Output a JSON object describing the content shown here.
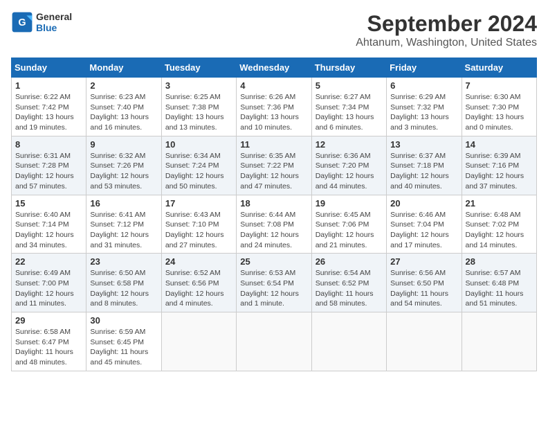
{
  "logo": {
    "line1": "General",
    "line2": "Blue"
  },
  "title": "September 2024",
  "subtitle": "Ahtanum, Washington, United States",
  "days_of_week": [
    "Sunday",
    "Monday",
    "Tuesday",
    "Wednesday",
    "Thursday",
    "Friday",
    "Saturday"
  ],
  "weeks": [
    [
      {
        "day": "1",
        "sunrise": "6:22 AM",
        "sunset": "7:42 PM",
        "daylight": "13 hours and 19 minutes."
      },
      {
        "day": "2",
        "sunrise": "6:23 AM",
        "sunset": "7:40 PM",
        "daylight": "13 hours and 16 minutes."
      },
      {
        "day": "3",
        "sunrise": "6:25 AM",
        "sunset": "7:38 PM",
        "daylight": "13 hours and 13 minutes."
      },
      {
        "day": "4",
        "sunrise": "6:26 AM",
        "sunset": "7:36 PM",
        "daylight": "13 hours and 10 minutes."
      },
      {
        "day": "5",
        "sunrise": "6:27 AM",
        "sunset": "7:34 PM",
        "daylight": "13 hours and 6 minutes."
      },
      {
        "day": "6",
        "sunrise": "6:29 AM",
        "sunset": "7:32 PM",
        "daylight": "13 hours and 3 minutes."
      },
      {
        "day": "7",
        "sunrise": "6:30 AM",
        "sunset": "7:30 PM",
        "daylight": "13 hours and 0 minutes."
      }
    ],
    [
      {
        "day": "8",
        "sunrise": "6:31 AM",
        "sunset": "7:28 PM",
        "daylight": "12 hours and 57 minutes."
      },
      {
        "day": "9",
        "sunrise": "6:32 AM",
        "sunset": "7:26 PM",
        "daylight": "12 hours and 53 minutes."
      },
      {
        "day": "10",
        "sunrise": "6:34 AM",
        "sunset": "7:24 PM",
        "daylight": "12 hours and 50 minutes."
      },
      {
        "day": "11",
        "sunrise": "6:35 AM",
        "sunset": "7:22 PM",
        "daylight": "12 hours and 47 minutes."
      },
      {
        "day": "12",
        "sunrise": "6:36 AM",
        "sunset": "7:20 PM",
        "daylight": "12 hours and 44 minutes."
      },
      {
        "day": "13",
        "sunrise": "6:37 AM",
        "sunset": "7:18 PM",
        "daylight": "12 hours and 40 minutes."
      },
      {
        "day": "14",
        "sunrise": "6:39 AM",
        "sunset": "7:16 PM",
        "daylight": "12 hours and 37 minutes."
      }
    ],
    [
      {
        "day": "15",
        "sunrise": "6:40 AM",
        "sunset": "7:14 PM",
        "daylight": "12 hours and 34 minutes."
      },
      {
        "day": "16",
        "sunrise": "6:41 AM",
        "sunset": "7:12 PM",
        "daylight": "12 hours and 31 minutes."
      },
      {
        "day": "17",
        "sunrise": "6:43 AM",
        "sunset": "7:10 PM",
        "daylight": "12 hours and 27 minutes."
      },
      {
        "day": "18",
        "sunrise": "6:44 AM",
        "sunset": "7:08 PM",
        "daylight": "12 hours and 24 minutes."
      },
      {
        "day": "19",
        "sunrise": "6:45 AM",
        "sunset": "7:06 PM",
        "daylight": "12 hours and 21 minutes."
      },
      {
        "day": "20",
        "sunrise": "6:46 AM",
        "sunset": "7:04 PM",
        "daylight": "12 hours and 17 minutes."
      },
      {
        "day": "21",
        "sunrise": "6:48 AM",
        "sunset": "7:02 PM",
        "daylight": "12 hours and 14 minutes."
      }
    ],
    [
      {
        "day": "22",
        "sunrise": "6:49 AM",
        "sunset": "7:00 PM",
        "daylight": "12 hours and 11 minutes."
      },
      {
        "day": "23",
        "sunrise": "6:50 AM",
        "sunset": "6:58 PM",
        "daylight": "12 hours and 8 minutes."
      },
      {
        "day": "24",
        "sunrise": "6:52 AM",
        "sunset": "6:56 PM",
        "daylight": "12 hours and 4 minutes."
      },
      {
        "day": "25",
        "sunrise": "6:53 AM",
        "sunset": "6:54 PM",
        "daylight": "12 hours and 1 minute."
      },
      {
        "day": "26",
        "sunrise": "6:54 AM",
        "sunset": "6:52 PM",
        "daylight": "11 hours and 58 minutes."
      },
      {
        "day": "27",
        "sunrise": "6:56 AM",
        "sunset": "6:50 PM",
        "daylight": "11 hours and 54 minutes."
      },
      {
        "day": "28",
        "sunrise": "6:57 AM",
        "sunset": "6:48 PM",
        "daylight": "11 hours and 51 minutes."
      }
    ],
    [
      {
        "day": "29",
        "sunrise": "6:58 AM",
        "sunset": "6:47 PM",
        "daylight": "11 hours and 48 minutes."
      },
      {
        "day": "30",
        "sunrise": "6:59 AM",
        "sunset": "6:45 PM",
        "daylight": "11 hours and 45 minutes."
      },
      null,
      null,
      null,
      null,
      null
    ]
  ],
  "labels": {
    "sunrise": "Sunrise:",
    "sunset": "Sunset:",
    "daylight": "Daylight:"
  }
}
